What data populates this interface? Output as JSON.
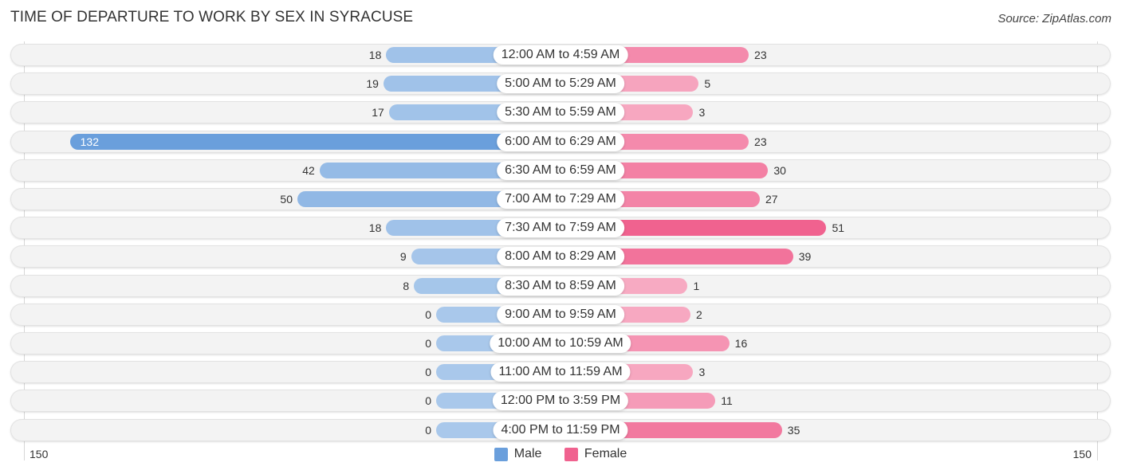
{
  "chart_data": {
    "type": "bar",
    "orientation": "horizontal-diverging",
    "title": "TIME OF DEPARTURE TO WORK BY SEX IN SYRACUSE",
    "source": "Source: ZipAtlas.com",
    "categories": [
      "12:00 AM to 4:59 AM",
      "5:00 AM to 5:29 AM",
      "5:30 AM to 5:59 AM",
      "6:00 AM to 6:29 AM",
      "6:30 AM to 6:59 AM",
      "7:00 AM to 7:29 AM",
      "7:30 AM to 7:59 AM",
      "8:00 AM to 8:29 AM",
      "8:30 AM to 8:59 AM",
      "9:00 AM to 9:59 AM",
      "10:00 AM to 10:59 AM",
      "11:00 AM to 11:59 AM",
      "12:00 PM to 3:59 PM",
      "4:00 PM to 11:59 PM"
    ],
    "series": [
      {
        "name": "Male",
        "color": "#6a9fdc",
        "values": [
          18,
          19,
          17,
          132,
          42,
          50,
          18,
          9,
          8,
          0,
          0,
          0,
          0,
          0
        ]
      },
      {
        "name": "Female",
        "color": "#f0628f",
        "values": [
          23,
          5,
          3,
          23,
          30,
          27,
          51,
          39,
          1,
          2,
          16,
          3,
          11,
          35
        ]
      }
    ],
    "axis": {
      "left_max_label": "150",
      "right_max_label": "150",
      "range": [
        0,
        150
      ]
    },
    "legend": {
      "position": "bottom-center",
      "items": [
        "Male",
        "Female"
      ]
    },
    "xlabel": "",
    "ylabel": ""
  }
}
